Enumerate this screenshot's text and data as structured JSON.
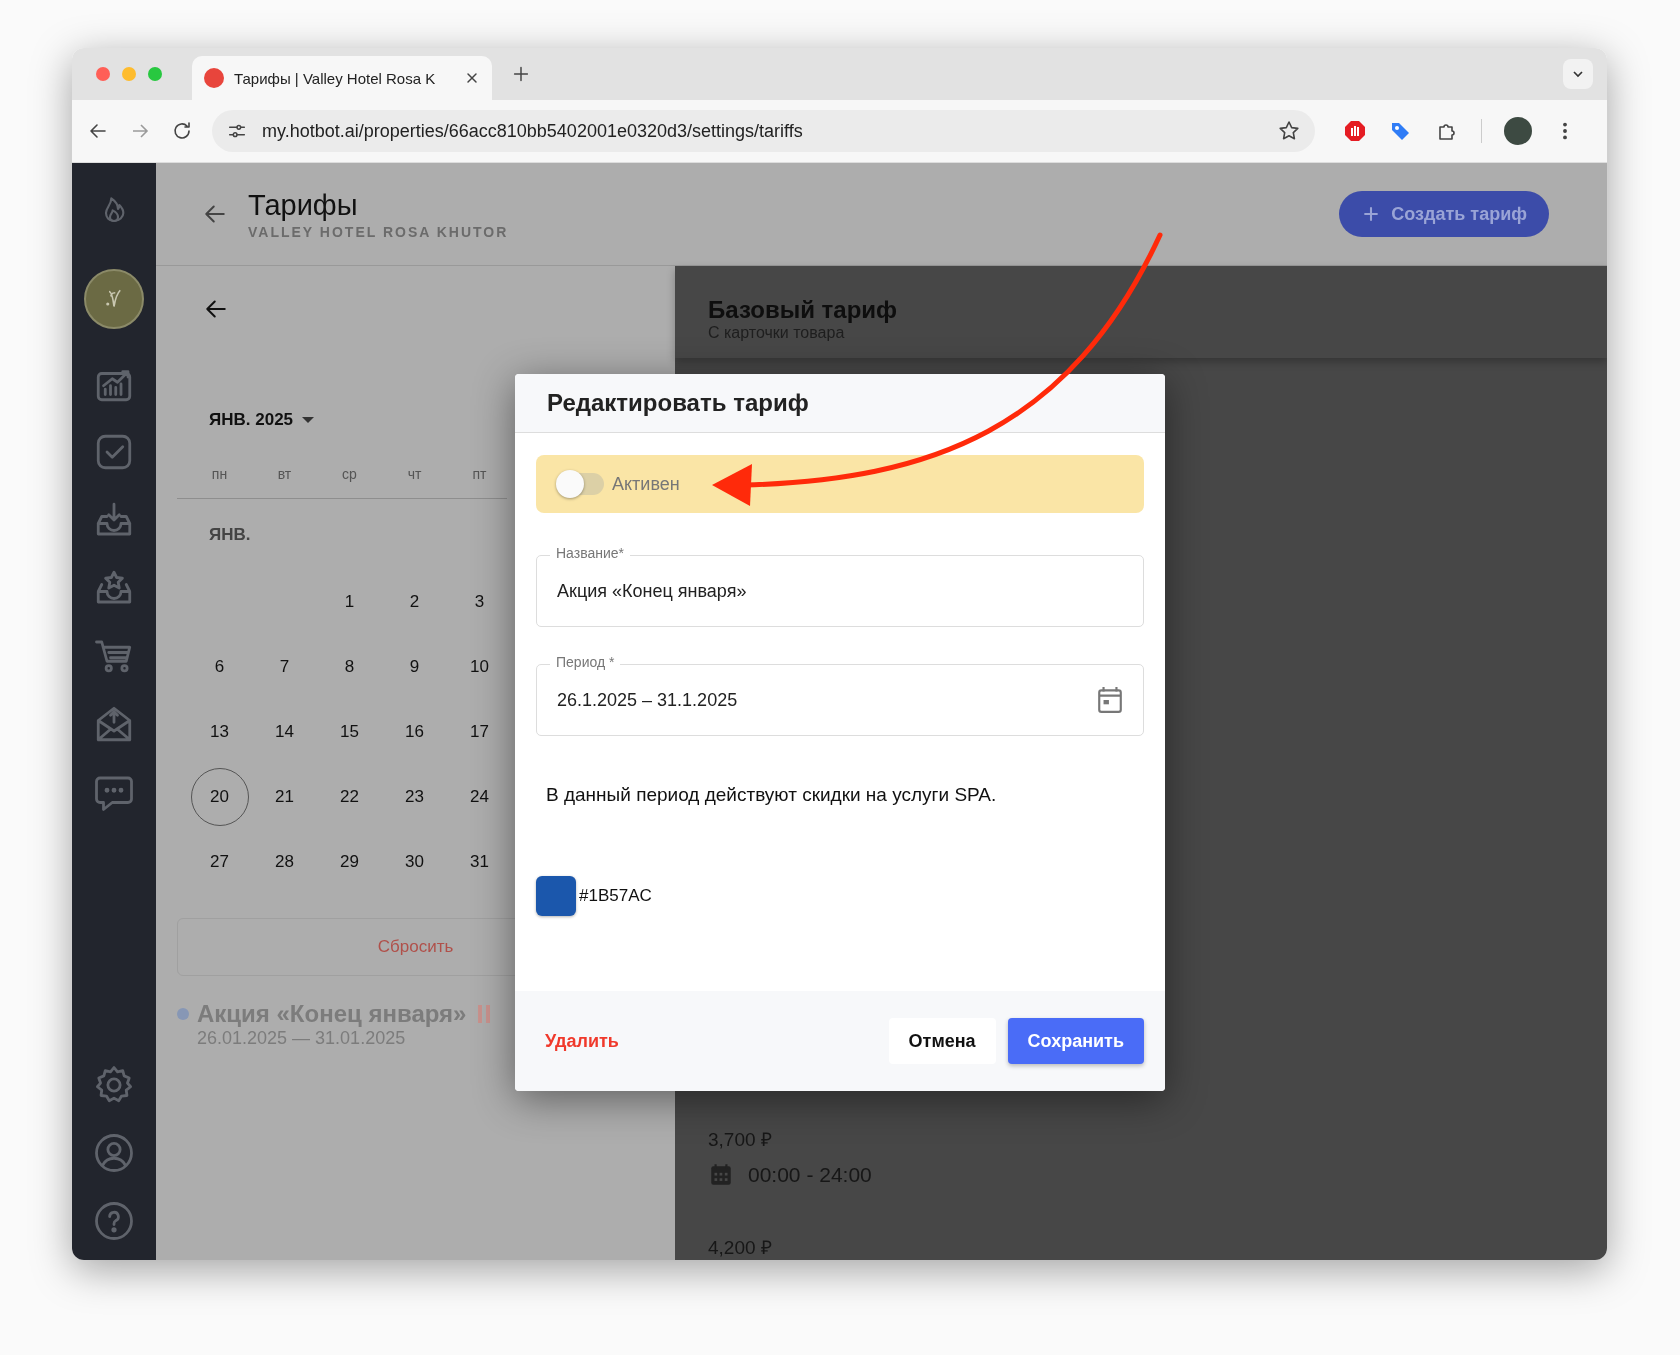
{
  "browser": {
    "tab_title": "Тарифы | Valley Hotel Rosa K",
    "url": "my.hotbot.ai/properties/66acc810bb5402001e0320d3/settings/tariffs"
  },
  "header": {
    "title": "Тарифы",
    "subtitle": "VALLEY HOTEL ROSA KHUTOR",
    "create_button": "Создать тариф"
  },
  "calendar": {
    "month": "ЯНВ. 2025",
    "weekdays": [
      "пн",
      "вт",
      "ср",
      "чт",
      "пт"
    ],
    "month_label": "ЯНВ.",
    "weeks": [
      {
        "days": [
          {
            "label": "1",
            "selected": false
          },
          {
            "label": "2",
            "selected": false
          },
          {
            "label": "3",
            "selected": false
          }
        ]
      },
      {
        "days": [
          {
            "label": "6",
            "selected": false
          },
          {
            "label": "7",
            "selected": false
          },
          {
            "label": "8",
            "selected": false
          },
          {
            "label": "9",
            "selected": false
          },
          {
            "label": "10",
            "selected": false
          }
        ]
      },
      {
        "days": [
          {
            "label": "13",
            "selected": false
          },
          {
            "label": "14",
            "selected": false
          },
          {
            "label": "15",
            "selected": false
          },
          {
            "label": "16",
            "selected": false
          },
          {
            "label": "17",
            "selected": false
          }
        ]
      },
      {
        "days": [
          {
            "label": "20",
            "selected": true
          },
          {
            "label": "21",
            "selected": false
          },
          {
            "label": "22",
            "selected": false
          },
          {
            "label": "23",
            "selected": false
          },
          {
            "label": "24",
            "selected": false
          }
        ]
      },
      {
        "days": [
          {
            "label": "27",
            "selected": false
          },
          {
            "label": "28",
            "selected": false
          },
          {
            "label": "29",
            "selected": false
          },
          {
            "label": "30",
            "selected": false
          },
          {
            "label": "31",
            "selected": false
          }
        ]
      }
    ],
    "reset_button": "Сбросить"
  },
  "tariffs": [
    {
      "name": "Акция «Конец января»",
      "dates": "26.01.2025 — 31.01.2025",
      "color": "#8797b5",
      "paused": true
    }
  ],
  "base_tariff": {
    "title": "Базовый тариф",
    "subtitle": "С карточки товара",
    "prices": [
      {
        "price": "3,700 ₽",
        "time": "00:00 - 24:00"
      },
      {
        "price": "4,200 ₽"
      }
    ]
  },
  "dialog": {
    "title": "Редактировать тариф",
    "active": {
      "label": "Активен",
      "on": false
    },
    "name_field": {
      "label": "Название*",
      "value": "Акция «Конец января»"
    },
    "period_field": {
      "label": "Период *",
      "value": "26.1.2025 – 31.1.2025"
    },
    "description": "В данный период действуют скидки на услуги SPA.",
    "color_hex": "#1B57AC",
    "delete_button": "Удалить",
    "cancel_button": "Отмена",
    "save_button": "Сохранить"
  }
}
